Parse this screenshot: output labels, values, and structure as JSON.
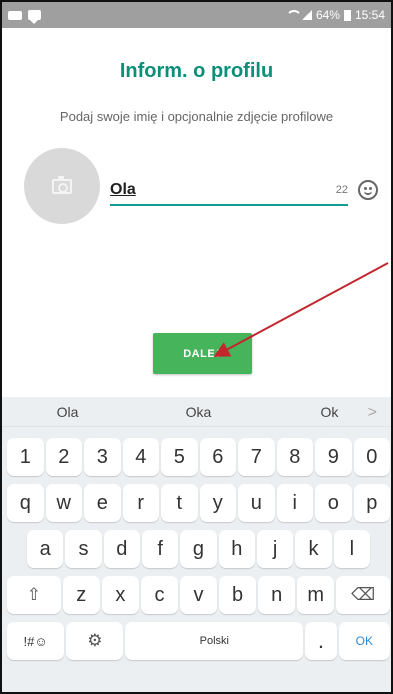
{
  "status_bar": {
    "left_icons": [
      "notification-icon",
      "chat-icon"
    ],
    "battery_percent": "64%",
    "time": "15:54"
  },
  "header": {
    "title": "Inform. o profilu",
    "subtitle": "Podaj swoje imię i opcjonalnie zdjęcie profilowe"
  },
  "profile": {
    "name_value": "Ola",
    "remaining_characters": "22"
  },
  "actions": {
    "next_label": "DALEJ"
  },
  "keyboard": {
    "suggestions": [
      "Ola",
      "Oka",
      "Ok"
    ],
    "suggestion_arrow": ">",
    "number_row": [
      "1",
      "2",
      "3",
      "4",
      "5",
      "6",
      "7",
      "8",
      "9",
      "0"
    ],
    "row_q": [
      "q",
      "w",
      "e",
      "r",
      "t",
      "y",
      "u",
      "i",
      "o",
      "p"
    ],
    "row_a": [
      "a",
      "s",
      "d",
      "f",
      "g",
      "h",
      "j",
      "k",
      "l"
    ],
    "row_z": [
      "z",
      "x",
      "c",
      "v",
      "b",
      "n",
      "m"
    ],
    "symbols_label": "!#☺",
    "space_label": "Polski",
    "period_label": ".",
    "ok_label": "OK"
  },
  "colors": {
    "accent": "#0c8f79",
    "underline": "#139b8f",
    "button": "#45b45b",
    "annotation_arrow": "#c1272d",
    "keyboard_action": "#2f88d4"
  }
}
